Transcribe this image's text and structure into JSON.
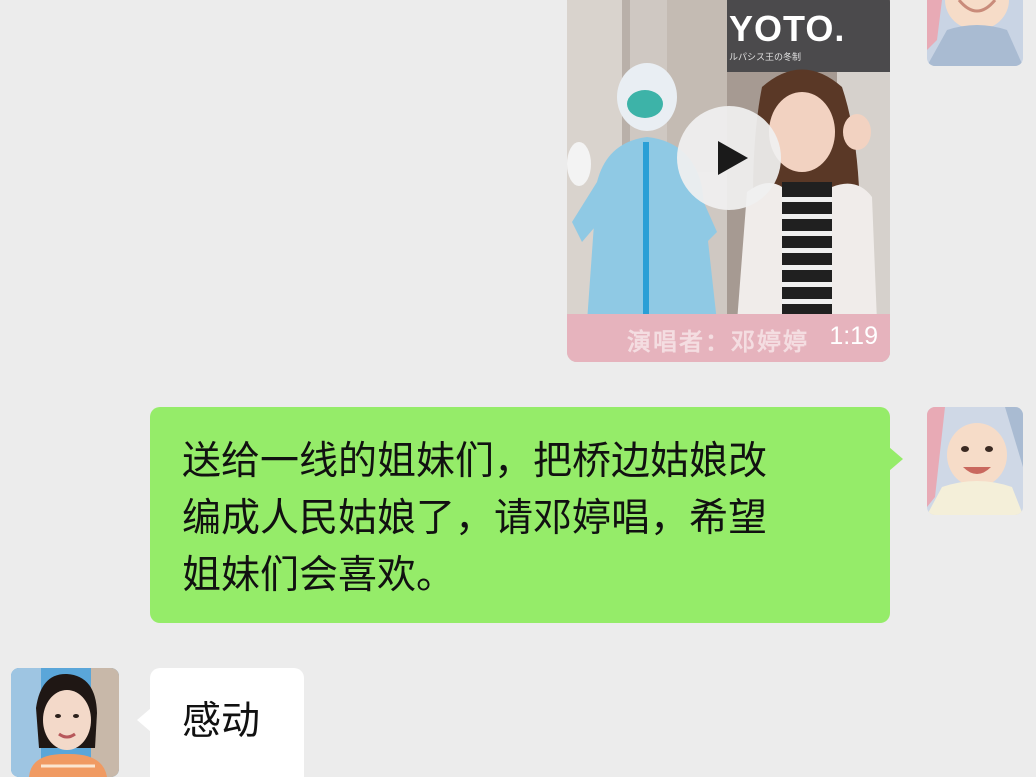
{
  "messages": [
    {
      "type": "video",
      "direction": "outgoing",
      "thumbnail_brand": "YOTO.",
      "thumbnail_brand_sub": "ルパシス王の冬制",
      "caption": "演唱者：邓婷婷",
      "duration": "1:19"
    },
    {
      "type": "text",
      "direction": "outgoing",
      "text": "送给一线的姐妹们，把桥边姑娘改\n编成人民姑娘了，请邓婷唱，希望\n姐妹们会喜欢。"
    },
    {
      "type": "text",
      "direction": "incoming",
      "text": "感动"
    }
  ],
  "colors": {
    "background": "#ececec",
    "outgoing_bubble": "#95ec69",
    "incoming_bubble": "#ffffff"
  }
}
